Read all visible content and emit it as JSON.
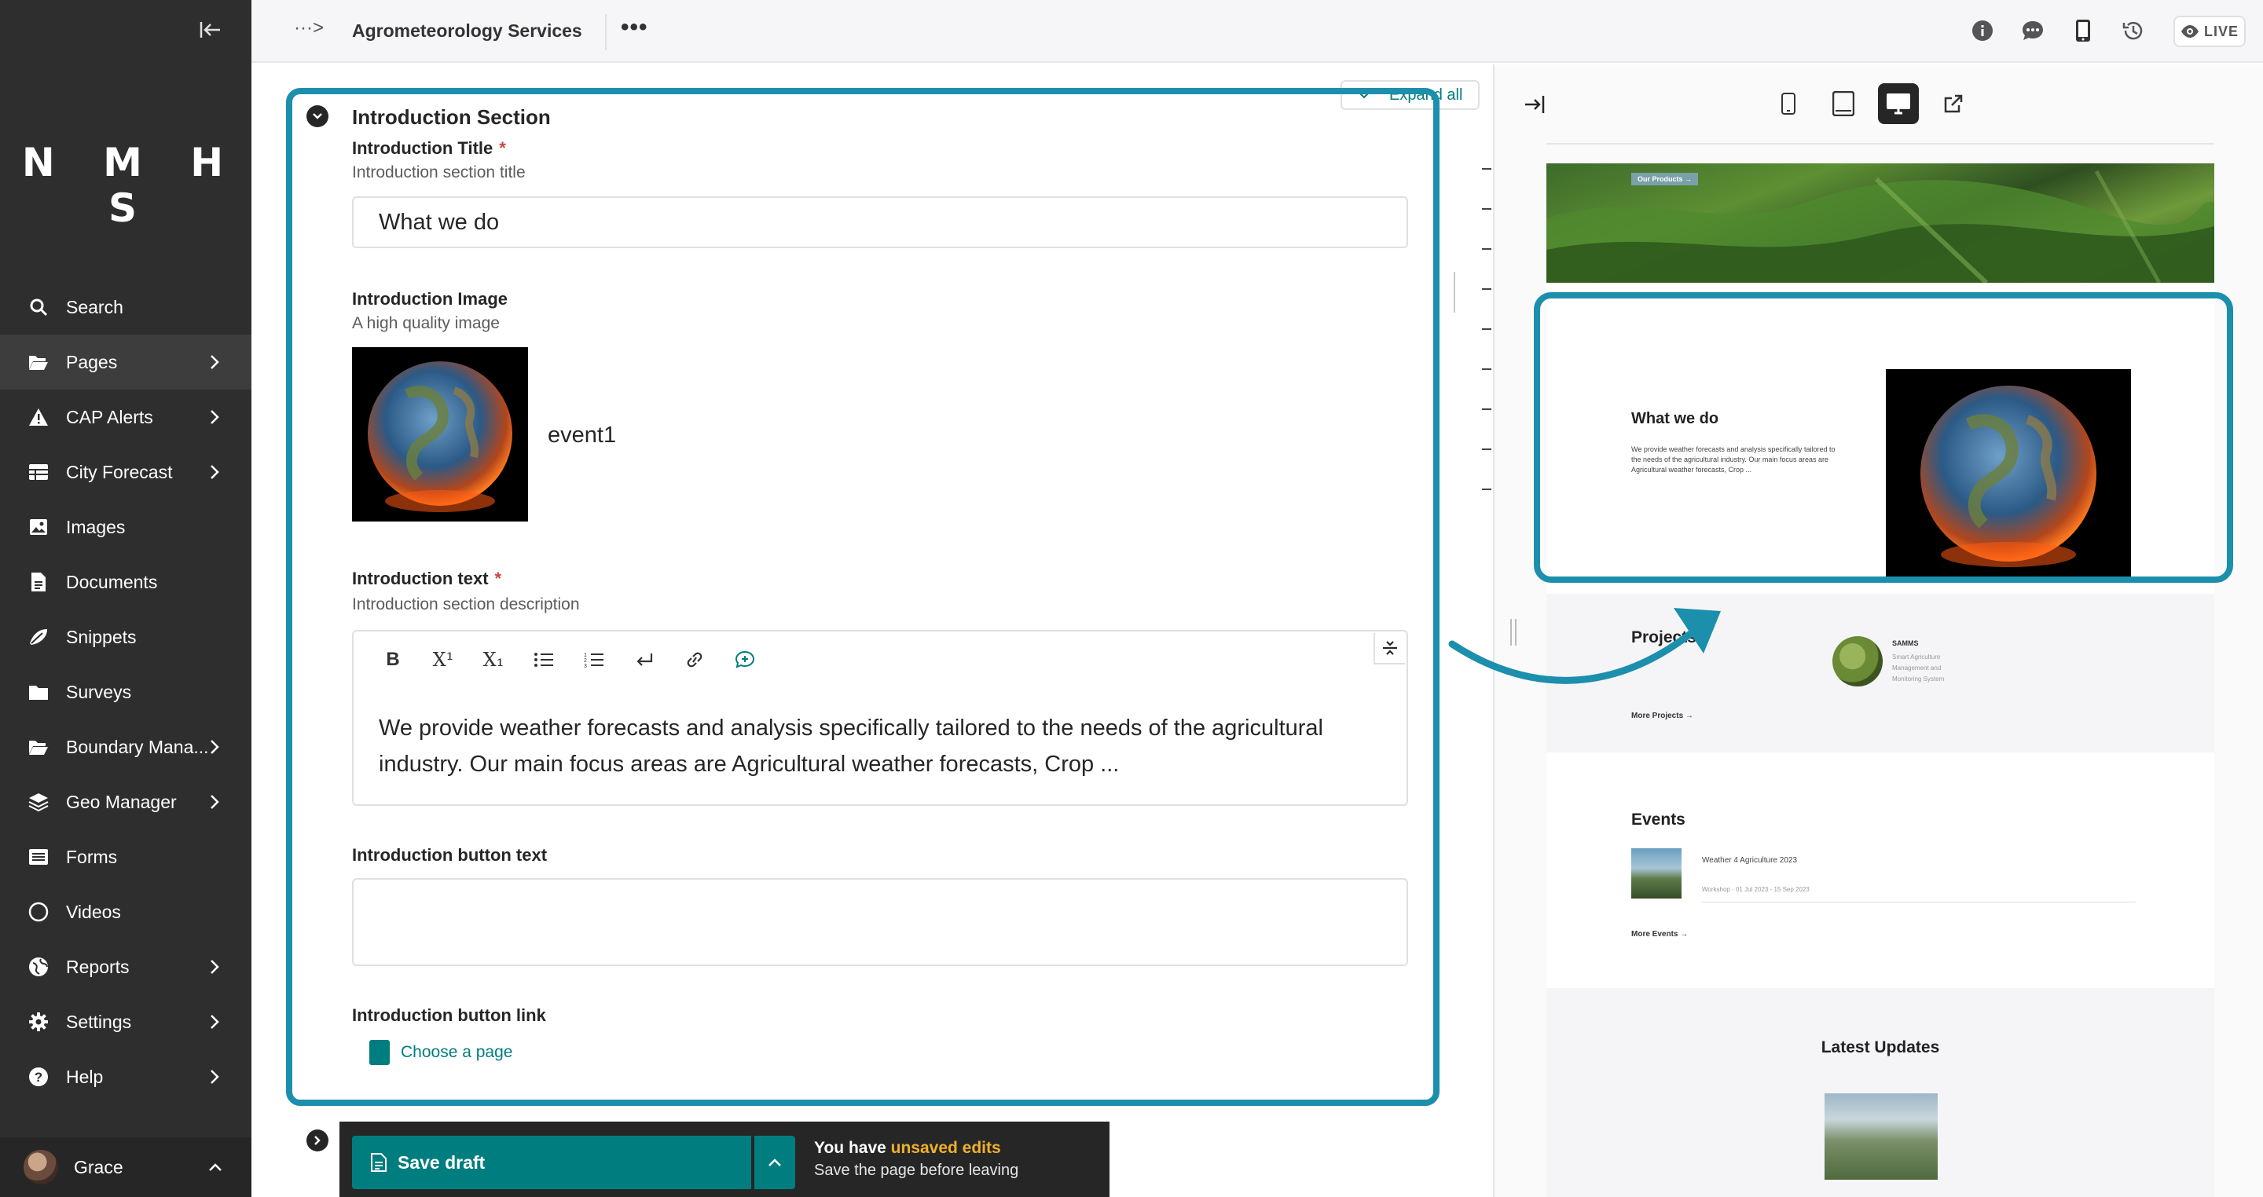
{
  "sidebar": {
    "logo": "N M H S",
    "items": [
      {
        "label": "Search",
        "icon": "search-icon"
      },
      {
        "label": "Pages",
        "icon": "folder-open-icon"
      },
      {
        "label": "CAP Alerts",
        "icon": "warning-icon"
      },
      {
        "label": "City Forecast",
        "icon": "table-icon"
      },
      {
        "label": "Images",
        "icon": "image-icon"
      },
      {
        "label": "Documents",
        "icon": "document-icon"
      },
      {
        "label": "Snippets",
        "icon": "snippet-icon"
      },
      {
        "label": "Surveys",
        "icon": "folder-icon"
      },
      {
        "label": "Boundary Mana...",
        "icon": "folder-open-icon"
      },
      {
        "label": "Geo Manager",
        "icon": "layers-icon"
      },
      {
        "label": "Forms",
        "icon": "list-icon"
      },
      {
        "label": "Videos",
        "icon": "circle-icon"
      },
      {
        "label": "Reports",
        "icon": "globe-icon"
      },
      {
        "label": "Settings",
        "icon": "cog-icon"
      },
      {
        "label": "Help",
        "icon": "help-icon"
      }
    ],
    "user": "Grace"
  },
  "header": {
    "breadcrumb_toggle": "···>",
    "title": "Agrometeorology Services",
    "more": "•••",
    "live": "LIVE"
  },
  "editor": {
    "expand_all": "Expand all",
    "section_title": "Introduction Section",
    "intro_title": {
      "label": "Introduction Title",
      "required": "*",
      "help": "Introduction section title",
      "value": "What we do"
    },
    "intro_image": {
      "label": "Introduction Image",
      "help": "A high quality image",
      "name": "event1"
    },
    "intro_text": {
      "label": "Introduction text",
      "required": "*",
      "help": "Introduction section description",
      "toolbar": {
        "bold": "B",
        "superscript": "X¹",
        "subscript": "X₁"
      },
      "value": "We provide weather forecasts and analysis specifically tailored to the needs of the agricultural industry. Our main focus areas are Agricultural weather forecasts, Crop ..."
    },
    "button_text": {
      "label": "Introduction button text",
      "value": ""
    },
    "button_link": {
      "label": "Introduction button link",
      "action": "Choose a page"
    }
  },
  "save_bar": {
    "save": "Save draft",
    "msg_prefix": "You have ",
    "msg_highlight": "unsaved edits",
    "msg_sub": "Save the page before leaving"
  },
  "preview": {
    "hero_button": "Our Products →",
    "what_we_do": {
      "title": "What we do",
      "body": "We provide weather forecasts and analysis specifically tailored to the needs of the agricultural industry. Our main focus areas are Agricultural weather forecasts, Crop ..."
    },
    "projects": {
      "title": "Projects",
      "item_name": "SAMMS",
      "item_desc": "Smart Agriculture Management and Monitoring System",
      "more": "More Projects →"
    },
    "events": {
      "title": "Events",
      "item_name": "Weather 4 Agriculture 2023",
      "item_meta": "Workshop · 01 Jul 2023 - 15 Sep 2023",
      "more": "More Events →"
    },
    "updates": {
      "title": "Latest Updates"
    }
  },
  "colors": {
    "accent": "#007d7e",
    "highlight_frame": "#1c8fad",
    "sidebar": "#2e2e2e",
    "warning": "#f0b02a",
    "required": "#cd4444"
  }
}
